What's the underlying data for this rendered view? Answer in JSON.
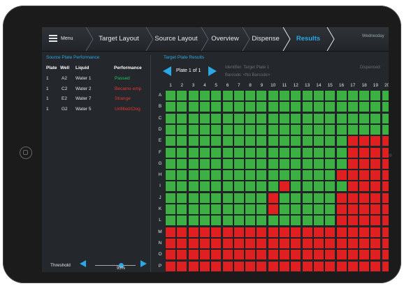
{
  "nav": {
    "menu_label": "Menu",
    "items": [
      "Target Layout",
      "Source Layout",
      "Overview",
      "Dispense",
      "Results"
    ],
    "active_index": 4,
    "date_text": "Wednesday"
  },
  "source_panel": {
    "title": "Source Plate Performance",
    "headers": [
      "Plate",
      "Well",
      "Liquid",
      "Performance"
    ],
    "rows": [
      {
        "plate": "1",
        "well": "A2",
        "liquid": "Water 1",
        "performance": "Passed",
        "status": "pass"
      },
      {
        "plate": "1",
        "well": "C2",
        "liquid": "Water 2",
        "performance": "Became emp",
        "status": "fail"
      },
      {
        "plate": "1",
        "well": "E2",
        "liquid": "Water 7",
        "performance": "Strange",
        "status": "fail"
      },
      {
        "plate": "1",
        "well": "G2",
        "liquid": "Water 5",
        "performance": "Unfilled/Clog",
        "status": "fail"
      }
    ]
  },
  "target_panel": {
    "title": "Target Plate Results",
    "plate_label": "Plate 1 of 1",
    "identifier": "Identifier: Target Plate 1",
    "barcode": "Barcode: <No Barcode>",
    "dispensed": "Dispensed:"
  },
  "grid": {
    "columns": [
      "1",
      "2",
      "3",
      "4",
      "5",
      "6",
      "7",
      "8",
      "9",
      "10",
      "11",
      "12",
      "13",
      "14",
      "15",
      "16",
      "17",
      "18",
      "19",
      "20"
    ],
    "rows": [
      "A",
      "B",
      "C",
      "D",
      "E",
      "F",
      "G",
      "H",
      "I",
      "J",
      "K",
      "L",
      "M",
      "N",
      "O",
      "P"
    ],
    "red_wells": {
      "E": [
        17,
        18,
        19,
        20
      ],
      "F": [
        17,
        18,
        19,
        20
      ],
      "G": [
        17,
        18,
        19,
        20
      ],
      "H": [
        16,
        17,
        18,
        19,
        20
      ],
      "I": [
        11,
        17,
        18,
        19,
        20
      ],
      "J": [
        10,
        16,
        17,
        18,
        19,
        20
      ],
      "K": [
        10,
        16,
        17,
        18,
        19,
        20
      ],
      "L": [
        16,
        17,
        18,
        19,
        20
      ],
      "M": "all",
      "N": "all",
      "O": "all",
      "P": "all"
    }
  },
  "threshold": {
    "label": "Threshold",
    "value": "95%"
  },
  "colors": {
    "accent": "#2aa8e6",
    "pass": "#22c55e",
    "fail": "#e53935",
    "well_green": "#3cb043",
    "well_red": "#e02020"
  }
}
